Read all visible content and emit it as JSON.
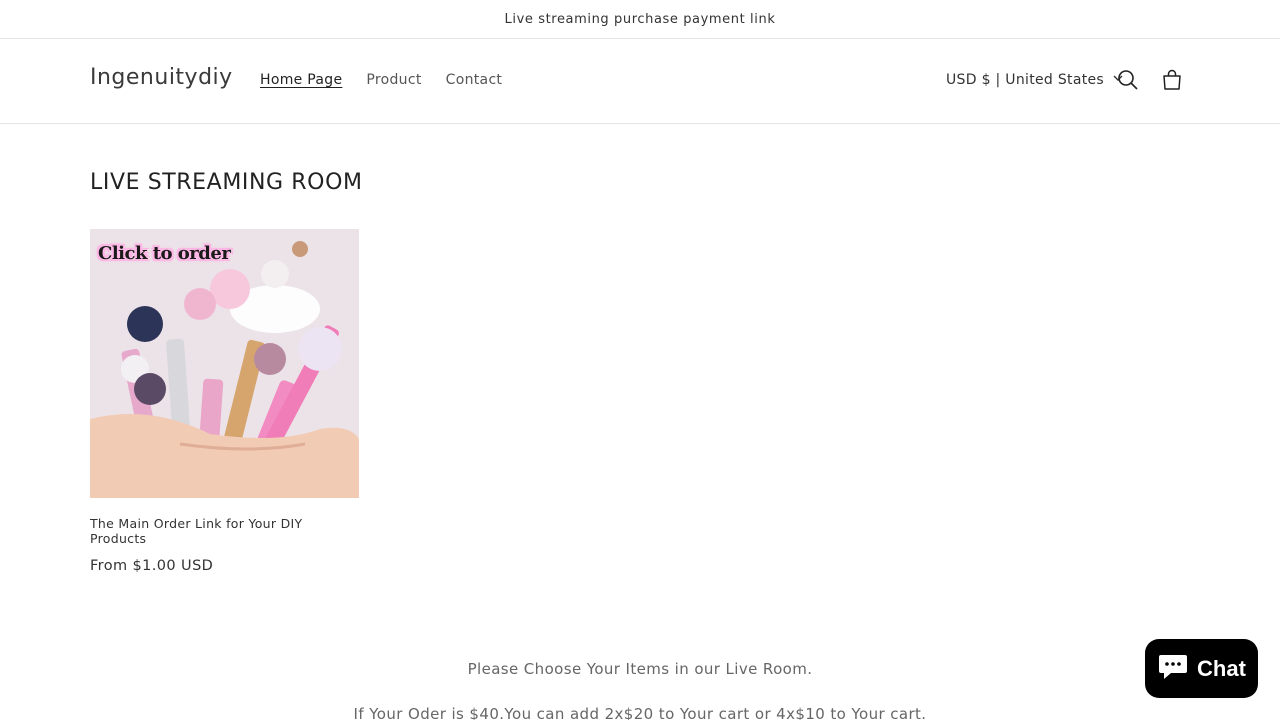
{
  "announcement": {
    "text": "Live streaming purchase payment link"
  },
  "header": {
    "logo": "Ingenuitydiy",
    "nav": [
      {
        "label": "Home Page",
        "active": true
      },
      {
        "label": "Product",
        "active": false
      },
      {
        "label": "Contact",
        "active": false
      }
    ],
    "currency": "USD $ | United States",
    "icons": {
      "search": "search-icon",
      "cart": "cart-icon",
      "dropdown": "chevron-down-icon"
    }
  },
  "collection": {
    "title": "LIVE STREAMING ROOM",
    "products": [
      {
        "image_overlay_text": "Click to order",
        "title": "The Main Order Link for Your DIY Products",
        "price": "From $1.00 USD"
      }
    ]
  },
  "footer": {
    "line1": "Please Choose Your Items in our Live Room.",
    "line2": "If Your Oder is $40.You can add 2x$20 to Your cart or 4x$10 to Your cart."
  },
  "chat": {
    "label": "Chat",
    "icon": "chat-bubble-icon",
    "bg": "#000000"
  }
}
